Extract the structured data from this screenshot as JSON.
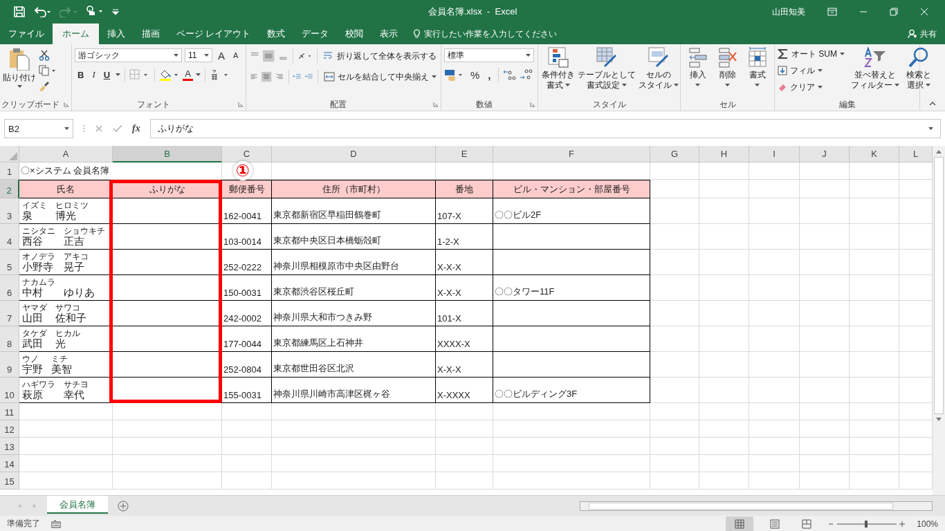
{
  "window": {
    "title": "会員名簿.xlsx  -  Excel",
    "user": "山田知美"
  },
  "tabs": [
    {
      "label": "ファイル",
      "selected": false
    },
    {
      "label": "ホーム",
      "selected": true
    },
    {
      "label": "挿入",
      "selected": false
    },
    {
      "label": "描画",
      "selected": false
    },
    {
      "label": "ページ レイアウト",
      "selected": false
    },
    {
      "label": "数式",
      "selected": false
    },
    {
      "label": "データ",
      "selected": false
    },
    {
      "label": "校閲",
      "selected": false
    },
    {
      "label": "表示",
      "selected": false
    }
  ],
  "tell_me": "実行したい作業を入力してください",
  "share": "共有",
  "ribbon": {
    "clipboard": {
      "name": "クリップボード",
      "paste": "貼り付け"
    },
    "font": {
      "name": "フォント",
      "font_name": "游ゴシック",
      "font_size": "11",
      "grow": "A",
      "shrink": "A",
      "bold": "B",
      "italic": "I",
      "underline": "U",
      "font_color": "A"
    },
    "alignment": {
      "name": "配置",
      "wrap": "折り返して全体を表示する",
      "merge": "セルを結合して中央揃え"
    },
    "number": {
      "name": "数値",
      "format": "標準",
      "percent": "%",
      "comma": ","
    },
    "styles": {
      "name": "スタイル",
      "buttons": [
        [
          "条件付き",
          "書式"
        ],
        [
          "テーブルとして",
          "書式設定"
        ],
        [
          "セルの",
          "スタイル"
        ]
      ]
    },
    "cells": {
      "name": "セル",
      "buttons": [
        "挿入",
        "削除",
        "書式"
      ]
    },
    "editing": {
      "name": "編集",
      "autosum": "オート SUM",
      "fill": "フィル",
      "clear": "クリア",
      "buttons": [
        [
          "並べ替えと",
          "フィルター"
        ],
        [
          "検索と",
          "選択"
        ]
      ]
    }
  },
  "formula_bar": {
    "name_box": "B2",
    "fx": "fx",
    "value": "ふりがな"
  },
  "sheet": {
    "columns": [
      {
        "label": "A",
        "selected": false
      },
      {
        "label": "B",
        "selected": true
      },
      {
        "label": "C",
        "selected": false
      },
      {
        "label": "D",
        "selected": false
      },
      {
        "label": "E",
        "selected": false
      },
      {
        "label": "F",
        "selected": false
      },
      {
        "label": "G",
        "selected": false
      },
      {
        "label": "H",
        "selected": false
      },
      {
        "label": "I",
        "selected": false
      },
      {
        "label": "J",
        "selected": false
      },
      {
        "label": "K",
        "selected": false
      },
      {
        "label": "L",
        "selected": false
      }
    ],
    "title_row": {
      "number": "1",
      "selected": false,
      "text": "〇×システム 会員名簿"
    },
    "header_row": {
      "number": "2",
      "selected": true,
      "cells": [
        "氏名",
        "ふりがな",
        "郵便番号",
        "住所（市町村）",
        "番地",
        "ビル・マンション・部屋番号"
      ]
    },
    "records": [
      {
        "number": "3",
        "selected": false,
        "name": [
          {
            "kana": "イズミ",
            "text": "泉"
          },
          {
            "kana": "ヒロミツ",
            "text": "博光"
          }
        ],
        "postal": "162-0041",
        "address": "東京都新宿区早稲田鶴巻町",
        "lot": "107-X",
        "building": "〇〇ビル2F"
      },
      {
        "number": "4",
        "selected": false,
        "name": [
          {
            "kana": "ニシタニ",
            "text": "西谷"
          },
          {
            "kana": "ショウキチ",
            "text": "正吉"
          }
        ],
        "postal": "103-0014",
        "address": "東京都中央区日本橋蛎殻町",
        "lot": "1-2-X"
      },
      {
        "number": "5",
        "selected": false,
        "name": [
          {
            "kana": "オノデラ",
            "text": "小野寺"
          },
          {
            "kana": "アキコ",
            "text": "晃子"
          }
        ],
        "postal": "252-0222",
        "address": "神奈川県相模原市中央区由野台",
        "lot": "X-X-X"
      },
      {
        "number": "6",
        "selected": false,
        "name": [
          {
            "kana": "ナカムラ",
            "text": "中村"
          },
          {
            "text": "ゆりあ"
          }
        ],
        "postal": "150-0031",
        "address": "東京都渋谷区桜丘町",
        "lot": "X-X-X",
        "building": "〇〇タワー11F"
      },
      {
        "number": "7",
        "selected": false,
        "name": [
          {
            "kana": "ヤマダ",
            "text": "山田"
          },
          {
            "kana": "サワコ",
            "text": "佐和子"
          }
        ],
        "postal": "242-0002",
        "address": "神奈川県大和市つきみ野",
        "lot": "101-X"
      },
      {
        "number": "8",
        "selected": false,
        "name": [
          {
            "kana": "タケダ",
            "text": "武田"
          },
          {
            "kana": "ヒカル",
            "text": "光"
          }
        ],
        "postal": "177-0044",
        "address": "東京都練馬区上石神井",
        "lot": "XXXX-X"
      },
      {
        "number": "9",
        "selected": false,
        "name": [
          {
            "kana": "ウノ",
            "text": "宇野"
          },
          {
            "kana": "ミチ",
            "text": "美智"
          }
        ],
        "postal": "252-0804",
        "address": "東京都世田谷区北沢",
        "lot": "X-X-X"
      },
      {
        "number": "10",
        "selected": false,
        "name": [
          {
            "kana": "ハギワラ",
            "text": "萩原"
          },
          {
            "kana": "サチヨ",
            "text": "幸代"
          }
        ],
        "postal": "155-0031",
        "address": "神奈川県川崎市高津区梶ヶ谷",
        "lot": "X-XXXX",
        "building": "〇〇ビルディング3F"
      }
    ],
    "empty_rows": [
      {
        "number": "11",
        "selected": false
      },
      {
        "number": "12",
        "selected": false
      },
      {
        "number": "13",
        "selected": false
      },
      {
        "number": "14",
        "selected": false
      },
      {
        "number": "15",
        "selected": false
      }
    ]
  },
  "callout": {
    "badge": "①"
  },
  "sheet_tabs": [
    {
      "label": "会員名簿",
      "selected": true
    }
  ],
  "status_bar": {
    "status": "準備完了",
    "zoom": "100%"
  }
}
